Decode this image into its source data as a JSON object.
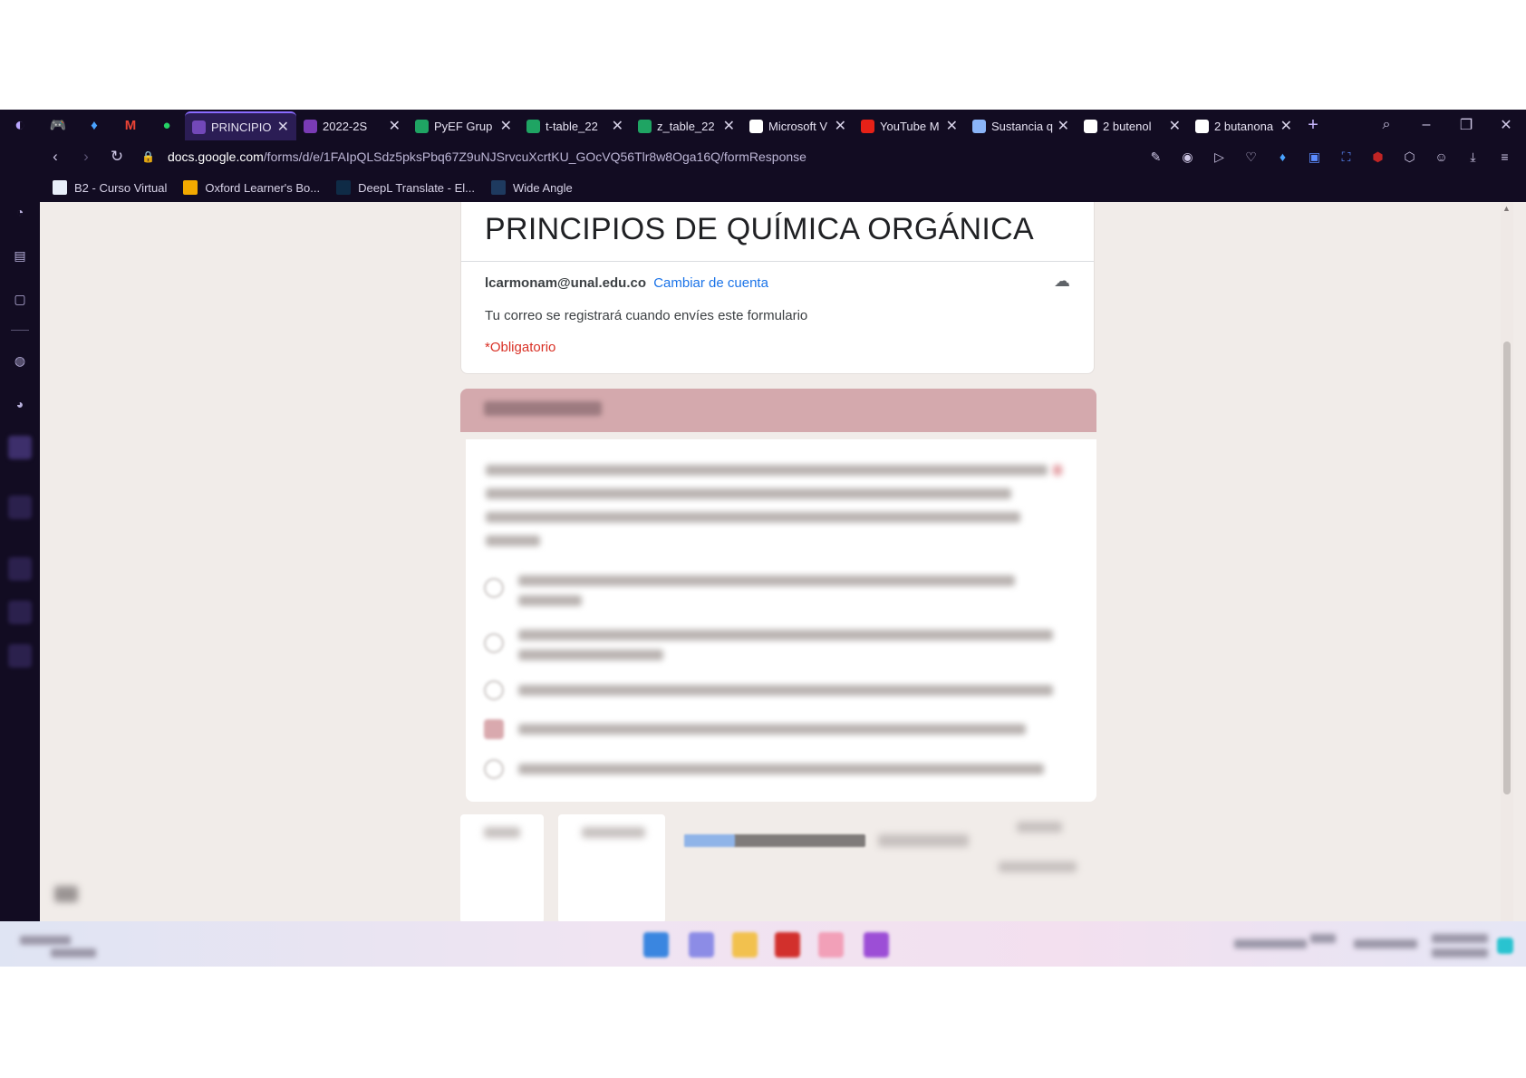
{
  "browser": {
    "tabs": [
      {
        "label": "PRINCIPIO",
        "icon": "google-forms-icon",
        "color": "#7248b9",
        "active": true
      },
      {
        "label": "2022-2S",
        "icon": "onenote-icon",
        "color": "#7a3bb5",
        "active": false
      },
      {
        "label": "PyEF Grup",
        "icon": "google-drive-icon",
        "color": "#1fa463",
        "active": false
      },
      {
        "label": "t-table_22",
        "icon": "google-drive-icon",
        "color": "#1fa463",
        "active": false
      },
      {
        "label": "z_table_22",
        "icon": "google-drive-icon",
        "color": "#1fa463",
        "active": false
      },
      {
        "label": "Microsoft V",
        "icon": "globe-icon",
        "color": "#ffffff",
        "active": false
      },
      {
        "label": "YouTube M",
        "icon": "youtube-icon",
        "color": "#e62117",
        "active": false
      },
      {
        "label": "Sustancia q",
        "icon": "mask-icon",
        "color": "#8ab4f8",
        "active": false
      },
      {
        "label": "2 butenol",
        "icon": "google-icon",
        "color": "#ffffff",
        "active": false
      },
      {
        "label": "2 butanona",
        "icon": "google-icon",
        "color": "#ffffff",
        "active": false
      }
    ],
    "url_host": "docs.google.com",
    "url_path": "/forms/d/e/1FAIpQLSdz5pksPbq67Z9uNJSrvcuXcrtKU_GOcVQ56Tlr8w8Oga16Q/formResponse",
    "bookmarks": [
      {
        "label": "B2 - Curso Virtual",
        "color": "#e8eef9"
      },
      {
        "label": "Oxford Learner's Bo...",
        "color": "#f2a900"
      },
      {
        "label": "DeepL Translate - El...",
        "color": "#0f2b46"
      },
      {
        "label": "Wide Angle",
        "color": "#1e3a5f"
      }
    ]
  },
  "form": {
    "title": "PRINCIPIOS DE QUÍMICA ORGÁNICA",
    "account_email": "lcarmonam@unal.edu.co",
    "switch_account": "Cambiar de cuenta",
    "email_note": "Tu correo se registrará cuando envíes este formulario",
    "required_note": "*Obligatorio",
    "section_color": "#d4a9ad",
    "accent_color": "#1a73e8",
    "required_color": "#d93025",
    "options_count": 5,
    "selected_option_index": 3
  }
}
